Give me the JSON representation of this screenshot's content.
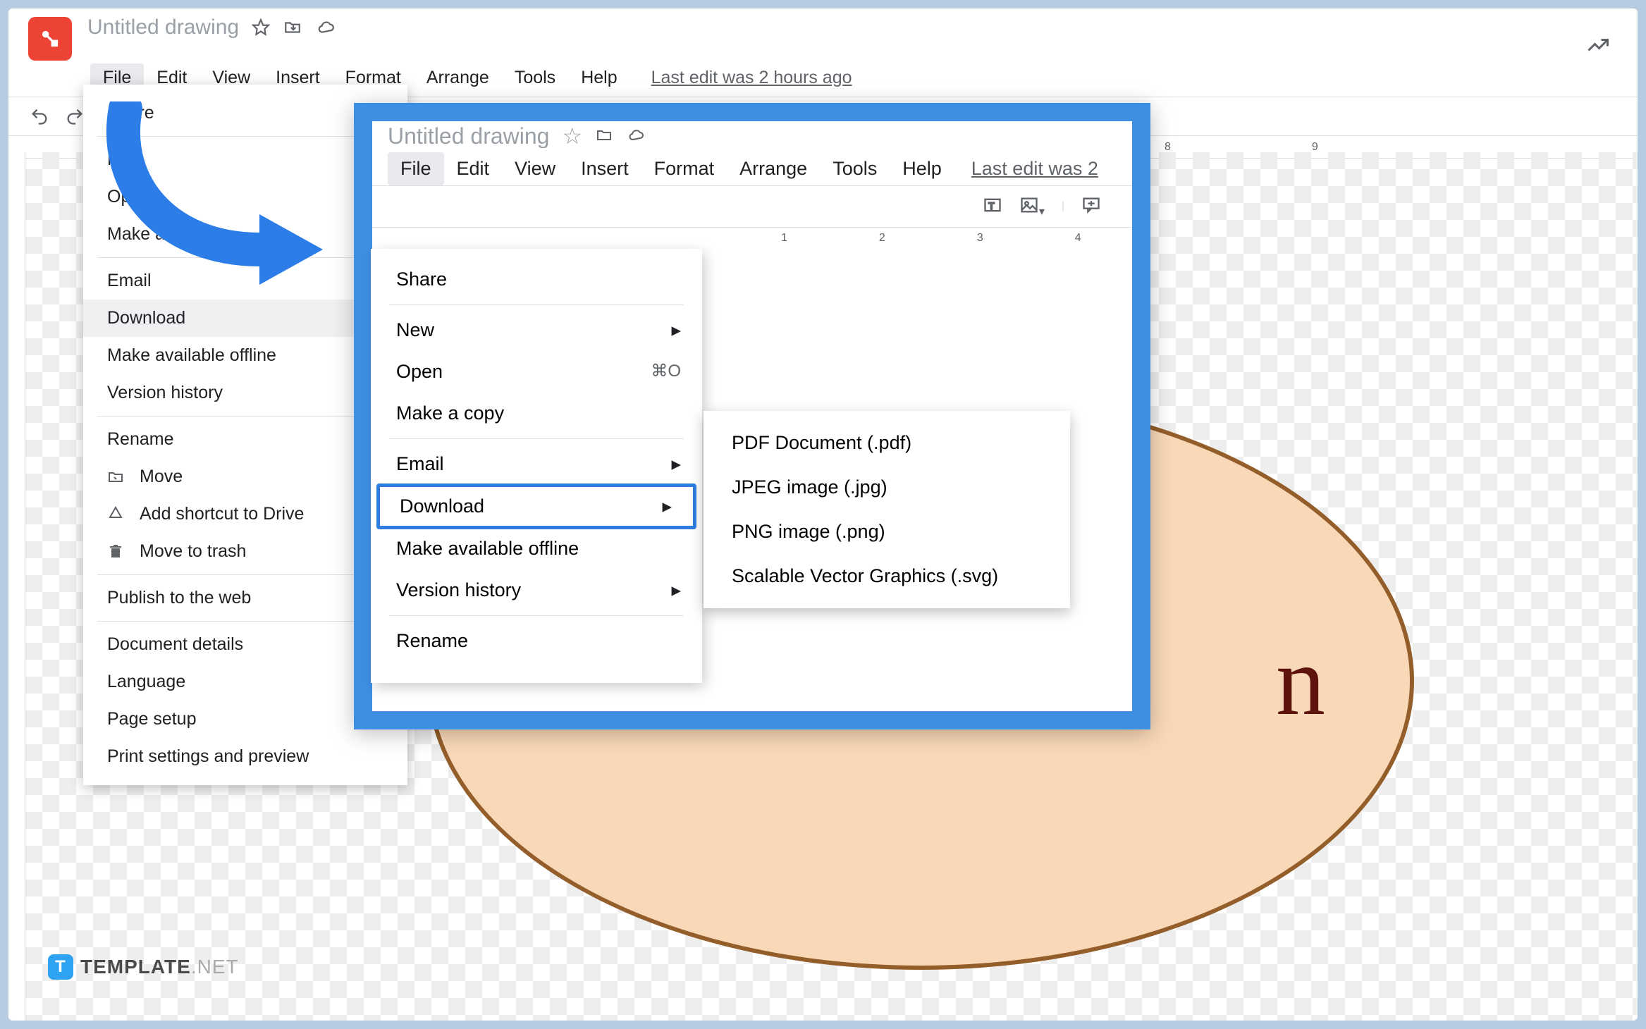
{
  "header": {
    "doc_title": "Untitled drawing"
  },
  "menubar": {
    "file": "File",
    "edit": "Edit",
    "view": "View",
    "insert": "Insert",
    "format": "Format",
    "arrange": "Arrange",
    "tools": "Tools",
    "help": "Help",
    "last_edit": "Last edit was 2 hours ago"
  },
  "bg_file_menu": {
    "share": "Share",
    "new": "New",
    "open": "Open",
    "make_a_copy": "Make a copy",
    "email": "Email",
    "download": "Download",
    "make_available_offline": "Make available offline",
    "version_history": "Version history",
    "rename": "Rename",
    "move": "Move",
    "add_shortcut": "Add shortcut to Drive",
    "move_to_trash": "Move to trash",
    "publish": "Publish to the web",
    "doc_details": "Document details",
    "language": "Language",
    "page_setup": "Page setup",
    "print_preview": "Print settings and preview"
  },
  "overlay": {
    "title": "Untitled drawing",
    "menubar": {
      "file": "File",
      "edit": "Edit",
      "view": "View",
      "insert": "Insert",
      "format": "Format",
      "arrange": "Arrange",
      "tools": "Tools",
      "help": "Help",
      "last_edit": "Last edit was 2"
    },
    "file_menu": {
      "share": "Share",
      "new": "New",
      "open": "Open",
      "open_shortcut": "⌘O",
      "make_a_copy": "Make a copy",
      "email": "Email",
      "download": "Download",
      "make_available_offline": "Make available offline",
      "version_history": "Version history",
      "rename": "Rename"
    },
    "download_submenu": {
      "pdf": "PDF Document (.pdf)",
      "jpg": "JPEG image (.jpg)",
      "png": "PNG image (.png)",
      "svg": "Scalable Vector Graphics (.svg)"
    },
    "ruler_marks": [
      "1",
      "2",
      "3",
      "4"
    ]
  },
  "ruler_marks": [
    "8",
    "9"
  ],
  "canvas": {
    "ellipse_text": "n"
  },
  "watermark": {
    "brand": "TEMPLATE",
    "suffix": ".NET"
  }
}
